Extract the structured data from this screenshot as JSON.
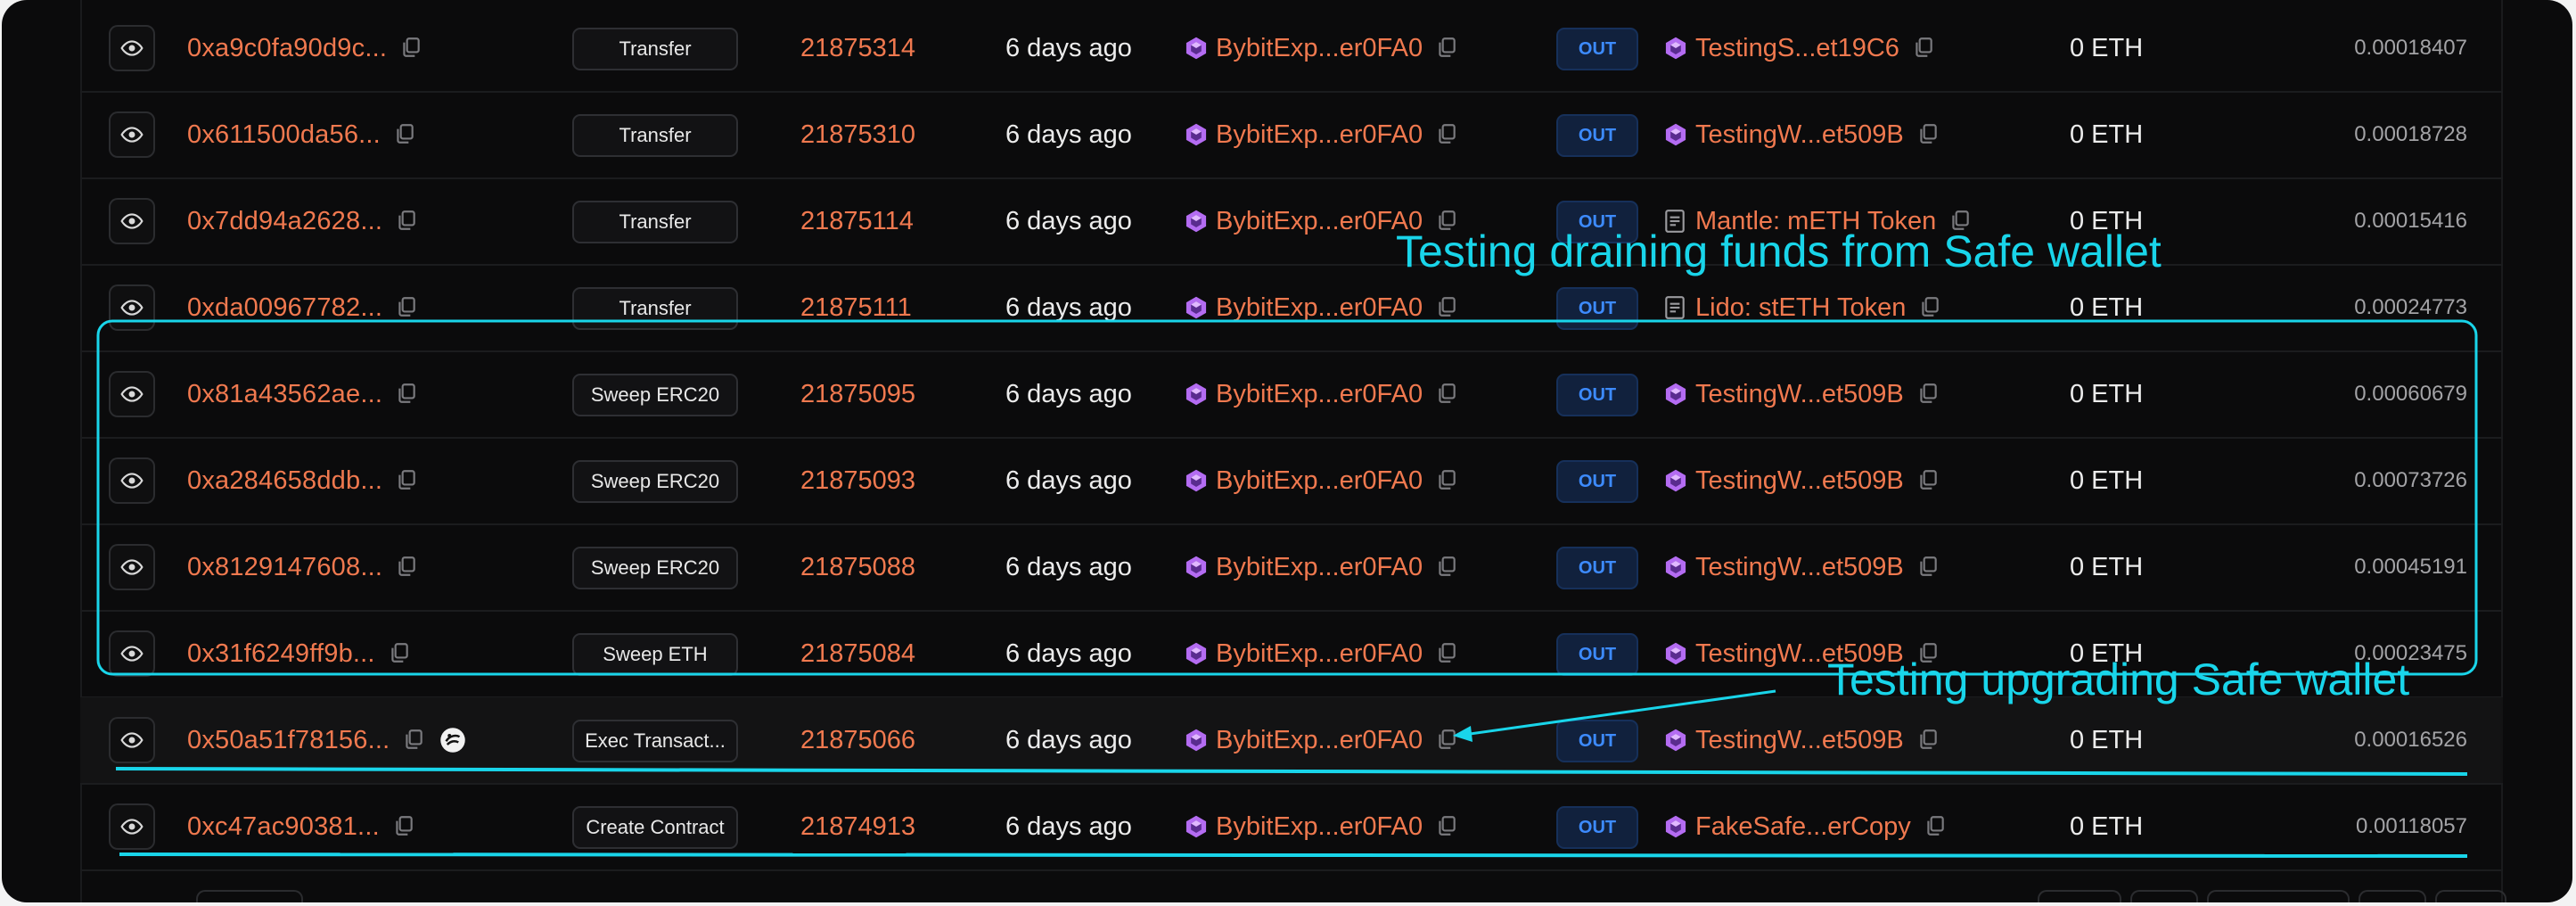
{
  "table": {
    "rows": [
      {
        "hash": "0xa9c0fa90d9c...",
        "method": "Transfer",
        "block": "21875314",
        "age": "6 days ago",
        "from": "BybitExp...er0FA0",
        "direction": "OUT",
        "to": "TestingS...et19C6",
        "to_icon": "contract-icon",
        "value": "0 ETH",
        "fee": "0.00018407",
        "has_extra_icon": false
      },
      {
        "hash": "0x611500da56...",
        "method": "Transfer",
        "block": "21875310",
        "age": "6 days ago",
        "from": "BybitExp...er0FA0",
        "direction": "OUT",
        "to": "TestingW...et509B",
        "to_icon": "contract-icon",
        "value": "0 ETH",
        "fee": "0.00018728",
        "has_extra_icon": false
      },
      {
        "hash": "0x7dd94a2628...",
        "method": "Transfer",
        "block": "21875114",
        "age": "6 days ago",
        "from": "BybitExp...er0FA0",
        "direction": "OUT",
        "to": "Mantle: mETH Token",
        "to_icon": "token-icon",
        "value": "0 ETH",
        "fee": "0.00015416",
        "has_extra_icon": false
      },
      {
        "hash": "0xda00967782...",
        "method": "Transfer",
        "block": "21875111",
        "age": "6 days ago",
        "from": "BybitExp...er0FA0",
        "direction": "OUT",
        "to": "Lido: stETH Token",
        "to_icon": "token-icon",
        "value": "0 ETH",
        "fee": "0.00024773",
        "has_extra_icon": false
      },
      {
        "hash": "0x81a43562ae...",
        "method": "Sweep ERC20",
        "block": "21875095",
        "age": "6 days ago",
        "from": "BybitExp...er0FA0",
        "direction": "OUT",
        "to": "TestingW...et509B",
        "to_icon": "contract-icon",
        "value": "0 ETH",
        "fee": "0.00060679",
        "has_extra_icon": false
      },
      {
        "hash": "0xa284658ddb...",
        "method": "Sweep ERC20",
        "block": "21875093",
        "age": "6 days ago",
        "from": "BybitExp...er0FA0",
        "direction": "OUT",
        "to": "TestingW...et509B",
        "to_icon": "contract-icon",
        "value": "0 ETH",
        "fee": "0.00073726",
        "has_extra_icon": false
      },
      {
        "hash": "0x8129147608...",
        "method": "Sweep ERC20",
        "block": "21875088",
        "age": "6 days ago",
        "from": "BybitExp...er0FA0",
        "direction": "OUT",
        "to": "TestingW...et509B",
        "to_icon": "contract-icon",
        "value": "0 ETH",
        "fee": "0.00045191",
        "has_extra_icon": false
      },
      {
        "hash": "0x31f6249ff9b...",
        "method": "Sweep ETH",
        "block": "21875084",
        "age": "6 days ago",
        "from": "BybitExp...er0FA0",
        "direction": "OUT",
        "to": "TestingW...et509B",
        "to_icon": "contract-icon",
        "value": "0 ETH",
        "fee": "0.00023475",
        "has_extra_icon": false
      },
      {
        "hash": "0x50a51f78156...",
        "method": "Exec Transact...",
        "block": "21875066",
        "age": "6 days ago",
        "from": "BybitExp...er0FA0",
        "direction": "OUT",
        "to": "TestingW...et509B",
        "to_icon": "contract-icon",
        "value": "0 ETH",
        "fee": "0.00016526",
        "has_extra_icon": true
      },
      {
        "hash": "0xc47ac90381...",
        "method": "Create Contract",
        "block": "21874913",
        "age": "6 days ago",
        "from": "BybitExp...er0FA0",
        "direction": "OUT",
        "to": "FakeSafe...erCopy",
        "to_icon": "contract-icon",
        "value": "0 ETH",
        "fee": "0.00118057",
        "has_extra_icon": false
      }
    ]
  },
  "annotations": {
    "draining": "Testing draining funds from Safe wallet",
    "upgrading": "Testing upgrading Safe wallet"
  },
  "colors": {
    "accent_orange": "#f0794f",
    "annotation_cyan": "#19d5ea",
    "out_badge_text": "#3d8bff",
    "contract_purple": "#b46cf2"
  }
}
